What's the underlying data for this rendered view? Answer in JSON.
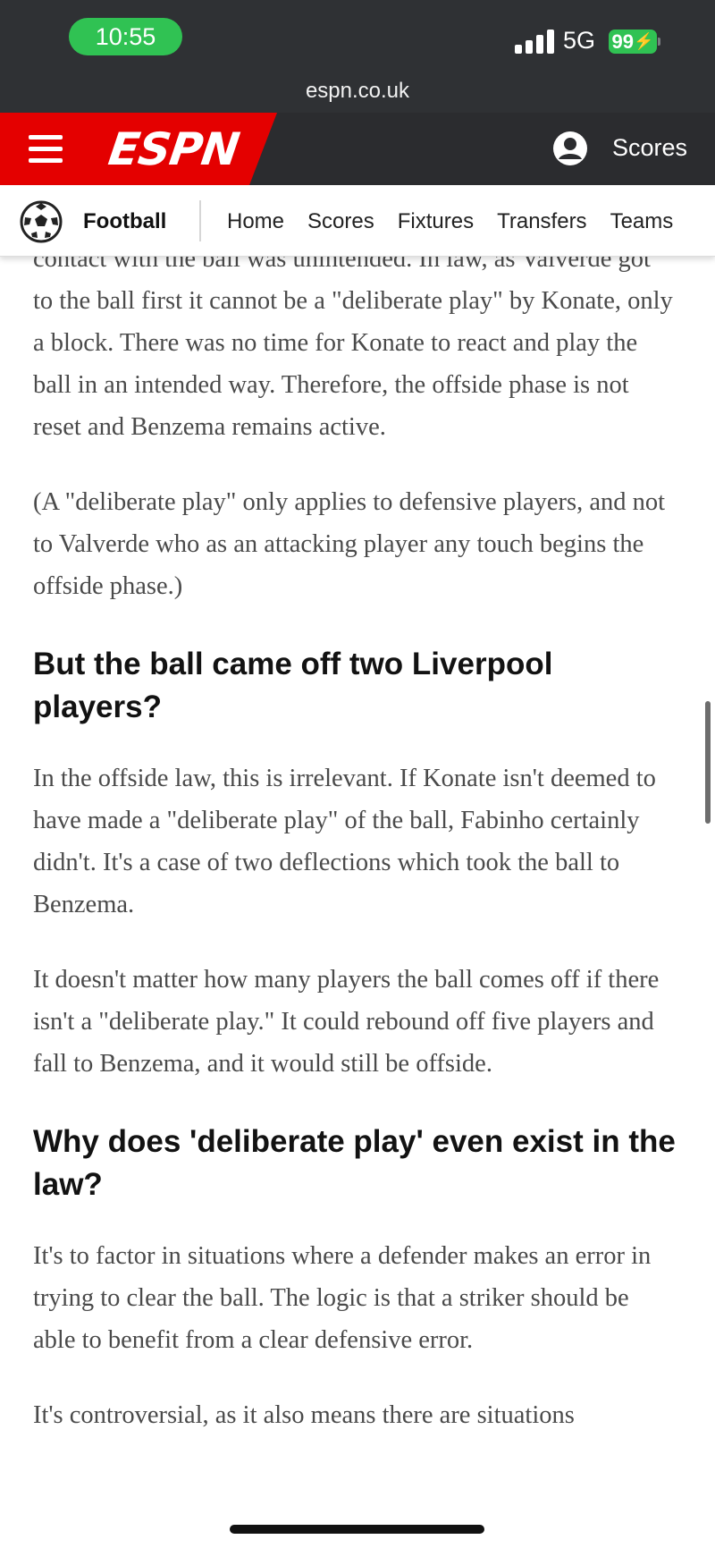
{
  "status": {
    "time": "10:55",
    "network": "5G",
    "battery": "99"
  },
  "browser": {
    "url": "espn.co.uk"
  },
  "header": {
    "logo": "ESPN",
    "scores_label": "Scores"
  },
  "subnav": {
    "sport": "Football",
    "links": [
      "Home",
      "Scores",
      "Fixtures",
      "Transfers",
      "Teams"
    ]
  },
  "article": {
    "p1": "contact with the ball was unintended. In law, as Valverde got to the ball first it cannot be a \"deliberate play\" by Konate, only a block. There was no time for Konate to react and play the ball in an intended way. Therefore, the offside phase is not reset and Benzema remains active.",
    "p2": "(A \"deliberate play\" only applies to defensive players, and not to Valverde who as an attacking player any touch begins the offside phase.)",
    "h1": "But the ball came off two Liverpool players?",
    "p3": "In the offside law, this is irrelevant. If Konate isn't deemed to have made a \"deliberate play\" of the ball, Fabinho certainly didn't. It's a case of two deflections which took the ball to Benzema.",
    "p4": "It doesn't matter how many players the ball comes off if there isn't a \"deliberate play.\" It could rebound off five players and fall to Benzema, and it would still be offside.",
    "h2": "Why does 'deliberate play' even exist in the law?",
    "p5": "It's to factor in situations where a defender makes an error in trying to clear the ball. The logic is that a striker should be able to benefit from a clear defensive error.",
    "p6": "It's controversial, as it also means there are situations"
  },
  "colors": {
    "espn_red": "#e40000",
    "status_green": "#30c253",
    "bar_dark": "#2f3134"
  }
}
